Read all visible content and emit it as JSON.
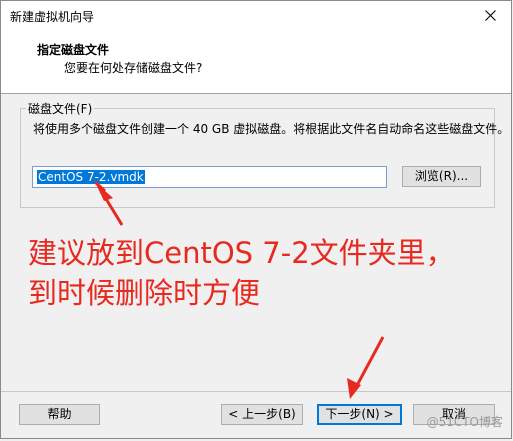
{
  "window": {
    "title": "新建虚拟机向导"
  },
  "header": {
    "title": "指定磁盘文件",
    "subtitle": "您要在何处存储磁盘文件?"
  },
  "disk_group": {
    "label": "磁盘文件(F)",
    "description": "将使用多个磁盘文件创建一个 40 GB 虚拟磁盘。将根据此文件名自动命名这些磁盘文件。",
    "file_value": "CentOS 7-2.vmdk",
    "browse_label": "浏览(R)..."
  },
  "annotation": {
    "line1": "建议放到CentOS 7-2文件夹里，",
    "line2": "到时候删除时方便"
  },
  "footer": {
    "help_label": "帮助",
    "back_label": "< 上一步(B)",
    "next_label": "下一步(N) >",
    "cancel_label": "取消"
  },
  "watermark": "@51CTO博客",
  "colors": {
    "annotation": "#e8291f",
    "selection": "#0078d7"
  },
  "icons": {
    "close": "close-icon",
    "arrow": "red-arrow"
  }
}
